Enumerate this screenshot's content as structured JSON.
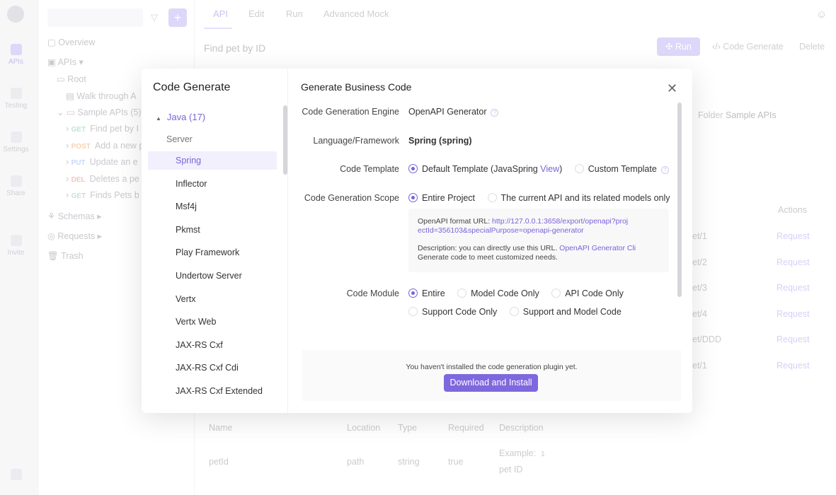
{
  "rail": {
    "items": [
      "APIs",
      "Testing",
      "Settings",
      "Share",
      "Invite"
    ]
  },
  "sidebar": {
    "overview": "Overview",
    "apis": "APIs",
    "root": "Root",
    "walk": "Walk through A",
    "sample": "Sample APIs",
    "sample_count": "(5)",
    "endpoints": [
      {
        "method": "GET",
        "label": "Find pet by I",
        "color": "#bfe6d3"
      },
      {
        "method": "POST",
        "label": "Add a new p",
        "color": "#f5d2b4"
      },
      {
        "method": "PUT",
        "label": "Update an e",
        "color": "#c8d8f5"
      },
      {
        "method": "DEL",
        "label": "Deletes a pe",
        "color": "#f5c4c4"
      },
      {
        "method": "GET",
        "label": "Finds Pets b",
        "color": "#bfe6d3"
      }
    ],
    "schemas": "Schemas",
    "requests": "Requests",
    "trash": "Trash"
  },
  "main": {
    "tabs": [
      "API",
      "Edit",
      "Run",
      "Advanced Mock"
    ],
    "title": "Find pet by ID",
    "run": "Run",
    "codegen": "Code Generate",
    "delete": "Delete",
    "folder_label": "Folder",
    "folder_value": "Sample APIs",
    "actions": "Actions",
    "rows": [
      {
        "path": "et/1",
        "action": "Request"
      },
      {
        "path": "et/2",
        "action": "Request"
      },
      {
        "path": "et/3",
        "action": "Request"
      },
      {
        "path": "et/4",
        "action": "Request"
      },
      {
        "path": "et/DDD",
        "action": "Request"
      },
      {
        "path": "et/1",
        "action": "Request"
      }
    ],
    "params_headers": [
      "Name",
      "Location",
      "Type",
      "Required",
      "Description"
    ],
    "param": {
      "name": "petId",
      "location": "path",
      "type": "string",
      "required": "true",
      "example_label": "Example:",
      "example_value": "1",
      "description": "pet ID"
    }
  },
  "modal": {
    "title": "Code Generate",
    "group": "Java",
    "group_count": "(17)",
    "subgroup": "Server",
    "items": [
      "Spring",
      "Inflector",
      "Msf4j",
      "Pkmst",
      "Play Framework",
      "Undertow Server",
      "Vertx",
      "Vertx Web",
      "JAX-RS Cxf",
      "JAX-RS Cxf Cdi",
      "JAX-RS Cxf Extended"
    ],
    "selected": "Spring",
    "right_title": "Generate Business Code",
    "engine_label": "Code Generation Engine",
    "engine_value": "OpenAPI Generator",
    "lang_label": "Language/Framework",
    "lang_value": "Spring (spring)",
    "template_label": "Code Template",
    "template_default": "Default Template (JavaSpring",
    "template_view": "View",
    "template_close": ")",
    "template_custom": "Custom Template",
    "scope_label": "Code Generation Scope",
    "scope_entire": "Entire Project",
    "scope_current": "The current API and its related models only",
    "url_label": "OpenAPI format URL:",
    "url": "http://127.0.0.1:3658/export/openapi?projectId=356103&specialPurpose=openapi-generator",
    "desc": "Description: you can directly use this URL.",
    "desc_link": "OpenAPI Generator Cli",
    "desc2": "Generate code to meet customized needs.",
    "module_label": "Code Module",
    "modules": [
      "Entire",
      "Model Code Only",
      "API Code Only",
      "Support Code Only",
      "Support and Model Code"
    ],
    "plugin_msg": "You haven't installed the code generation plugin yet.",
    "download": "Download and Install"
  },
  "colors": {
    "accent": "#7b62d8",
    "button": "#7f68de"
  }
}
